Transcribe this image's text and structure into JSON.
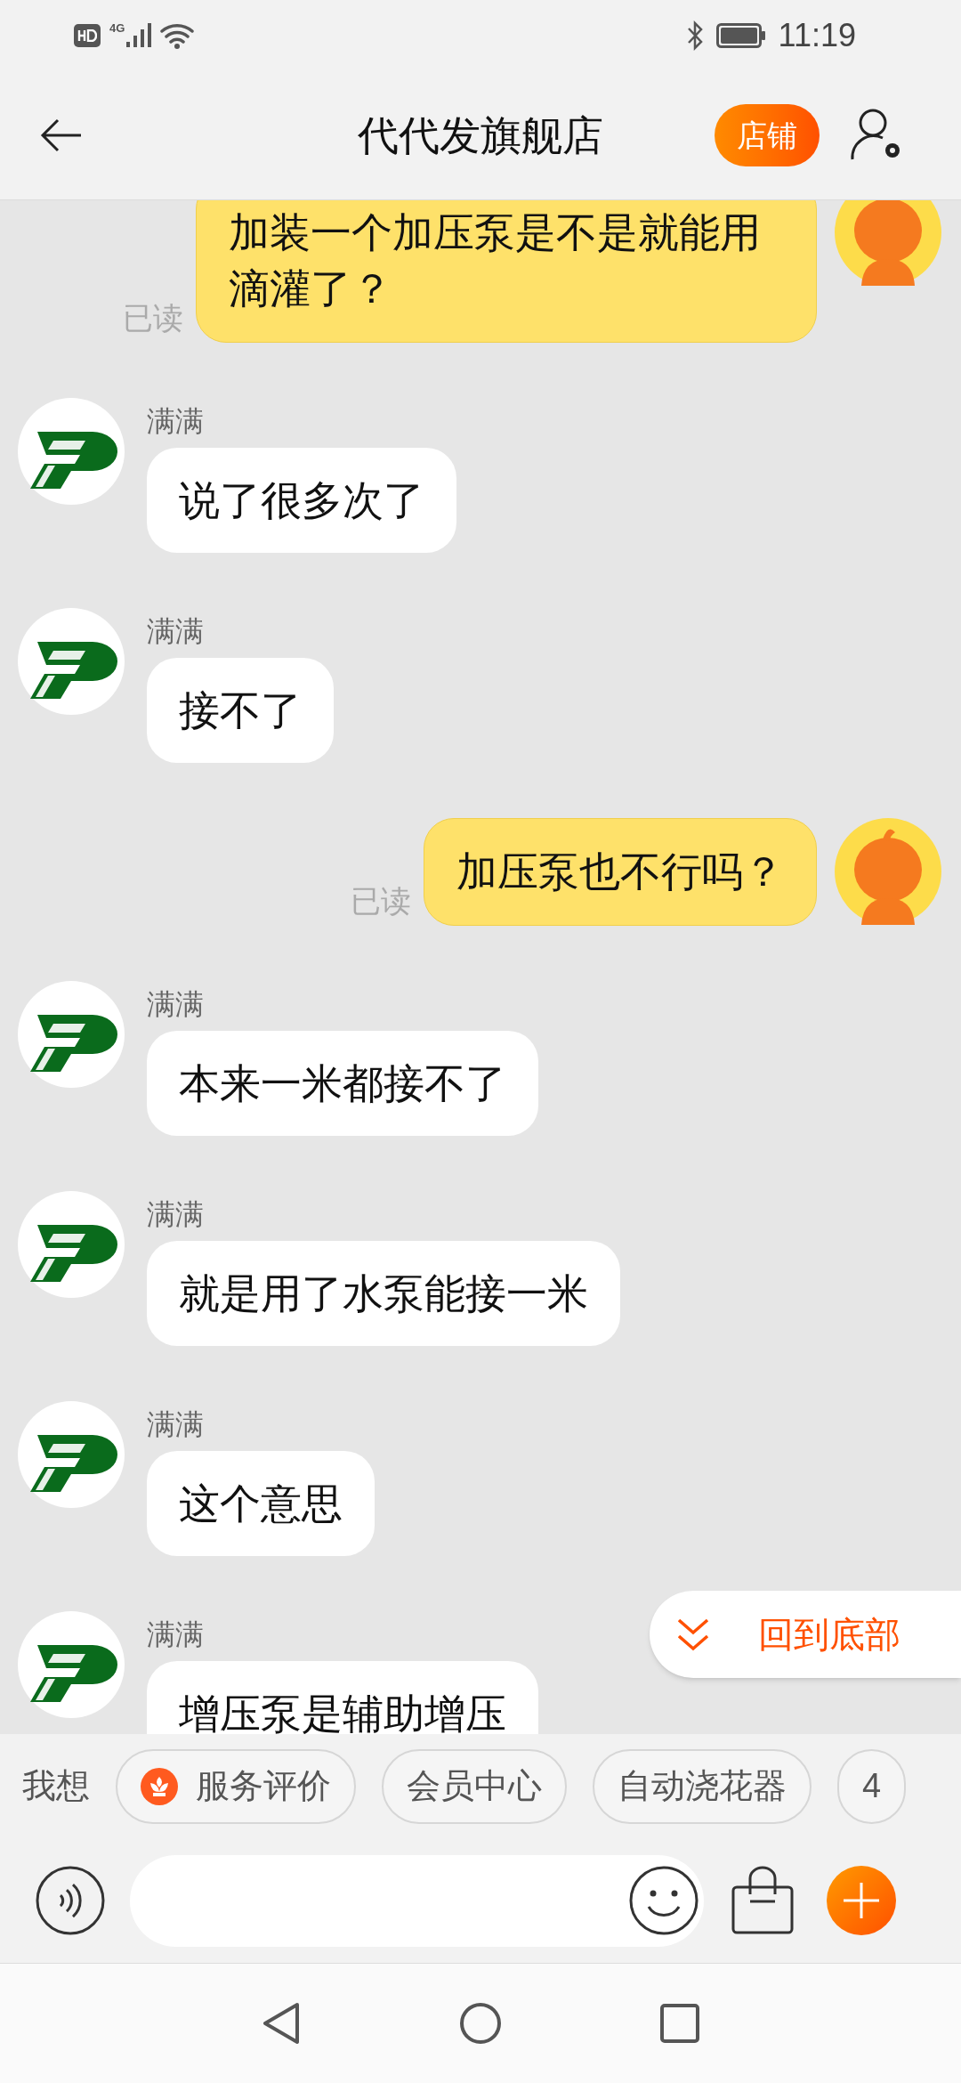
{
  "status_bar": {
    "network": "4G",
    "time": "11:19"
  },
  "header": {
    "title": "代代发旗舰店",
    "shop_button": "店铺"
  },
  "messages": [
    {
      "kind": "sent",
      "text": "加装一个加压泵是不是就能用滴灌了？",
      "status": "已读"
    },
    {
      "kind": "received",
      "sender": "满满",
      "text": "说了很多次了"
    },
    {
      "kind": "received",
      "sender": "满满",
      "text": "接不了"
    },
    {
      "kind": "sent",
      "text": "加压泵也不行吗？",
      "status": "已读"
    },
    {
      "kind": "received",
      "sender": "满满",
      "text": "本来一米都接不了"
    },
    {
      "kind": "received",
      "sender": "满满",
      "text": "就是用了水泵能接一米"
    },
    {
      "kind": "received",
      "sender": "满满",
      "text": "这个意思"
    },
    {
      "kind": "received",
      "sender": "满满",
      "text": "增压泵是辅助增压"
    }
  ],
  "scroll_to_bottom": "回到底部",
  "quick_bar": {
    "label": "我想",
    "chips": [
      {
        "kind": "service",
        "label": "服务评价"
      },
      {
        "kind": "text",
        "label": "会员中心"
      },
      {
        "kind": "text",
        "label": "自动浇花器"
      },
      {
        "kind": "text",
        "label": "4"
      }
    ]
  }
}
